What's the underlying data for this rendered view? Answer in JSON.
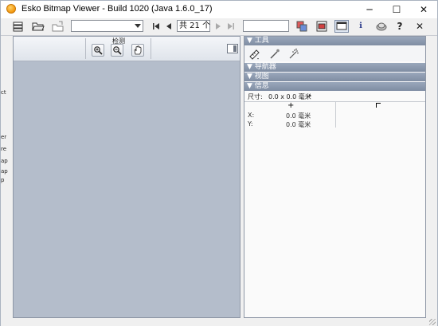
{
  "window": {
    "title": "Esko Bitmap Viewer - Build 1020 (Java 1.6.0_17)",
    "minimize": "─",
    "maximize": "☐",
    "close": "✕"
  },
  "toolbar": {
    "file_dropdown_value": "",
    "page_field": "共 21 个",
    "search_value": "",
    "info_label": "ℹ",
    "help_label": "?",
    "close_label": "✕"
  },
  "view_panel": {
    "group_label": "检测"
  },
  "right_panel": {
    "sections": {
      "tools": "▼ 工具",
      "navigator": "▼ 导航器",
      "view": "▼ 视图",
      "info": "▼ 信息"
    },
    "info": {
      "size_label": "尺寸:",
      "size_value": "0.0 x 0.0 毫米",
      "x_label": "X:",
      "x_value": "0.0 毫米",
      "y_label": "Y:",
      "y_value": "0.0 毫米"
    }
  },
  "background_fragment": [
    "ct",
    "er",
    "re",
    "ap",
    "ap",
    "p"
  ],
  "colors": {
    "canvas_bg": "#b4bdcb",
    "section_header": "#8a97ac",
    "app_icon": "#f2960b"
  }
}
